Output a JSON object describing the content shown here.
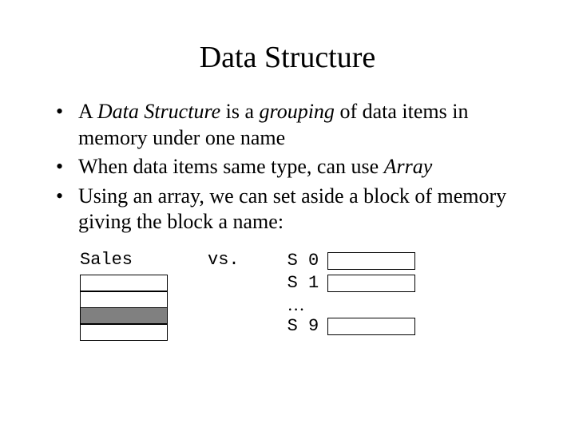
{
  "title": "Data Structure",
  "bullets": {
    "b1_pre": "A ",
    "b1_em1": "Data Structure",
    "b1_mid": " is a ",
    "b1_em2": "grouping",
    "b1_post": " of data items in memory under one name",
    "b2_pre": "When data items same type, can use ",
    "b2_em": "Array",
    "b3": "Using an array, we can set aside a block of memory giving the block a name:"
  },
  "diagram": {
    "sales_label": "Sales",
    "vs": "vs.",
    "rows": {
      "r0": "S 0",
      "r1": "S 1",
      "ellipsis": "…",
      "r9": "S 9"
    }
  }
}
